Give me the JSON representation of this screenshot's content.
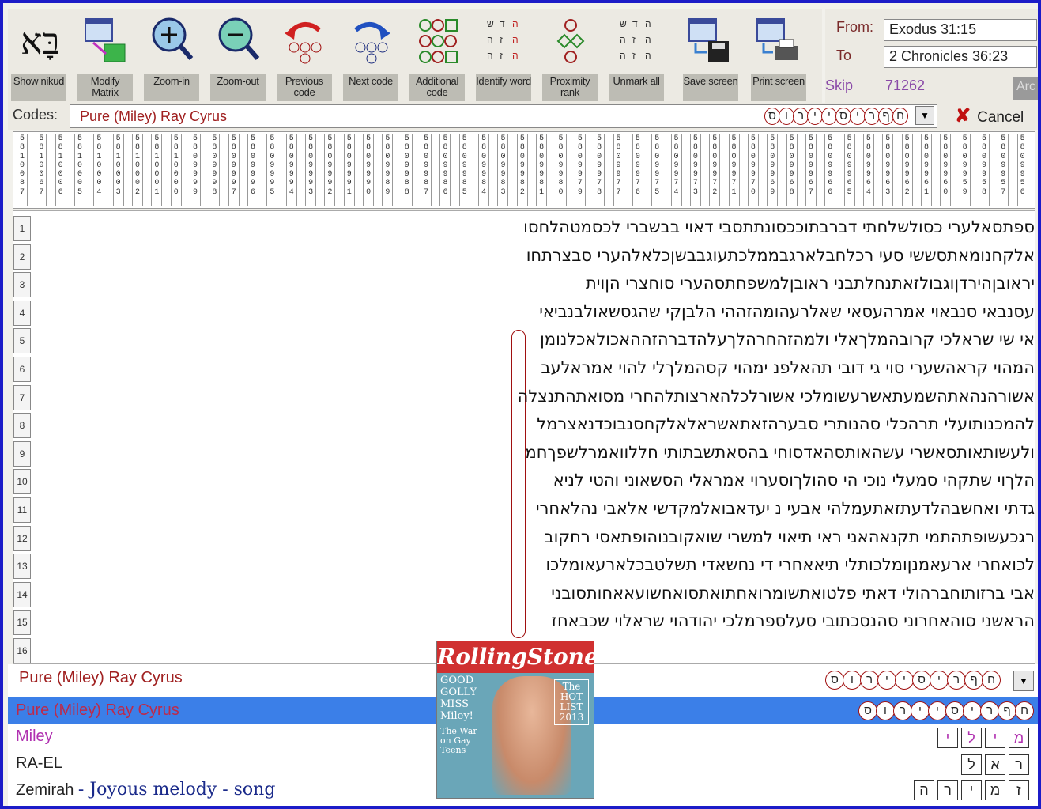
{
  "toolbar": {
    "buttons": [
      {
        "label": "Show nikud",
        "icon": "hebrew-nikud-icon"
      },
      {
        "label": "Modify Matrix",
        "icon": "modify-matrix-icon"
      },
      {
        "label": "Zoom-in",
        "icon": "zoom-in-icon"
      },
      {
        "label": "Zoom-out",
        "icon": "zoom-out-icon"
      },
      {
        "label": "Previous code",
        "icon": "previous-code-icon"
      },
      {
        "label": "Next code",
        "icon": "next-code-icon"
      },
      {
        "label": "Additional code",
        "icon": "additional-code-icon"
      },
      {
        "label": "Identify word",
        "icon": "identify-word-icon"
      },
      {
        "label": "Proximity rank",
        "icon": "proximity-rank-icon"
      },
      {
        "label": "Unmark all",
        "icon": "unmark-all-icon"
      },
      {
        "label": "Save screen",
        "icon": "save-screen-icon"
      },
      {
        "label": "Print screen",
        "icon": "print-screen-icon"
      }
    ]
  },
  "range": {
    "from_label": "From:",
    "from_value": "Exodus 31:15",
    "to_label": "To",
    "to_value": "2 Chronicles 36:23",
    "skip_label": "Skip",
    "skip_value": "71262",
    "arc_label": "Arc"
  },
  "codes": {
    "label": "Codes:",
    "value": "Pure (Miley) Ray Cyrus",
    "hebrew": [
      "ח",
      "ף",
      "ר",
      "י",
      "ס",
      "י",
      "י",
      "ר",
      "ו",
      "ס"
    ],
    "cancel_label": "Cancel"
  },
  "colheads": [
    "5810087",
    "5810067",
    "5810006",
    "5810005",
    "5810004",
    "5810003",
    "5810002",
    "5810001",
    "5810000",
    "5809999",
    "5809998",
    "5809997",
    "5809996",
    "5809995",
    "5809994",
    "5809993",
    "5809992",
    "5809991",
    "5809990",
    "5809989",
    "5809988",
    "5809987",
    "5809986",
    "5809985",
    "5809984",
    "5809983",
    "5809982",
    "5809981",
    "5809980",
    "5809979",
    "5809978",
    "5809977",
    "5809976",
    "5809975",
    "5809974",
    "5809973",
    "5809972",
    "5809971",
    "5809970",
    "5809969",
    "5809968",
    "5809967",
    "5809966",
    "5809965",
    "5809964",
    "5809963",
    "5809962",
    "5809961",
    "5809960",
    "5809959",
    "5809958",
    "5809957",
    "5809956"
  ],
  "rows": [
    {
      "n": "1",
      "text": "ספתסאלערי כסולשלחתי דברבתוככסונתתסבי דאוי בבשברי לכסמטהלחסו"
    },
    {
      "n": "2",
      "text": "אלקחנומאתסששי סעי רכלחבלארגבממלכתעוגבבשןכלאלהערי סבצרתחו"
    },
    {
      "n": "3",
      "text": "יראובןהירדןוגבולזאתנחלתבני ראובןלמשפחתסהערי סוחצרי הןוית"
    },
    {
      "n": "4",
      "text": "עסנבאי סנבאוי אמרהעסאי שאלרעהומהזההי הלבןקי שהגסשאולבנביאי"
    },
    {
      "n": "5",
      "text": "אי שי שראלכי קרובהמלךאלי ולמהזהחרהלךעלהדברהזההאכולאכלנומן"
    },
    {
      "n": "6",
      "text": "המהוי קראהשערי סוי גי דובי תהאלפנ ימהוי קסהמלךלי להוי אמראלעב"
    },
    {
      "n": "7",
      "text": "אשורהנהאתהשמעתאשרעשומלכי אשורלכלהארצותלהחרי מסואתהתנצלה"
    },
    {
      "n": "8",
      "text": "להמכנותועלי תרהכלי סהנותרי סבערהזאתאשראלאלקחסנבוכדנאצרמל"
    },
    {
      "n": "9",
      "text": "ולעשותאותסאשרי עשהאותסהאדסוחי בהסאתשבתותי חללוואמרלשפךחמ"
    },
    {
      "n": "10",
      "text": "הלךוי שתקהי סמעלי נוכי הי סהולךוסערוי אמראלי הסשאוני והטי לניא"
    },
    {
      "n": "11",
      "text": "גדתי ואחשבהלדעתזאתעמלהי אבעי נ יעדאבואלמקדשי אלאבי נהלאחרי"
    },
    {
      "n": "12",
      "text": "רגכעשופתהתמי תקנאהאני ראי תיאוי למשרי שואקובנוהופתאסי רחקוב"
    },
    {
      "n": "13",
      "text": "לכואחרי ארעאמנןומלכותלי תיאאחרי די נחשאדי תשלטבכלארעאומלכו"
    },
    {
      "n": "14",
      "text": "אבי ברזותוחברהולי דאתי פלטואתשומרואחתואתסואחשועאאחותסובני"
    },
    {
      "n": "15",
      "text": "הראשני סוהאחרוני סהנסכתובי סעלספרמלכי יהודהוי שראלוי שכבאחז"
    },
    {
      "n": "16",
      "text": ""
    }
  ],
  "bottom": {
    "code_text": "Pure (Miley) Ray Cyrus",
    "hebrew": [
      "ח",
      "ף",
      "ר",
      "י",
      "ס",
      "י",
      "י",
      "ר",
      "ו",
      "ס"
    ],
    "selected_text": "Pure (Miley) Ray Cyrus",
    "items": [
      {
        "label": "Miley",
        "color": "#b030b0",
        "letters": [
          "מ",
          "י",
          "ל",
          "י"
        ]
      },
      {
        "label": "RA-EL",
        "color": "#222222",
        "letters": [
          "ר",
          "א",
          "ל"
        ]
      },
      {
        "label": "Zemirah",
        "color": "#222222",
        "letters": [
          "ז",
          "מ",
          "י",
          "ר",
          "ה"
        ]
      }
    ],
    "zemirah_note": "- Joyous melody - song"
  },
  "magazine": {
    "masthead": "RollingStone",
    "cover_lines": "GOOD GOLLY MISS Miley!",
    "hot_list": "The HOT LIST 2013",
    "war": "The War on Gay Teens"
  }
}
